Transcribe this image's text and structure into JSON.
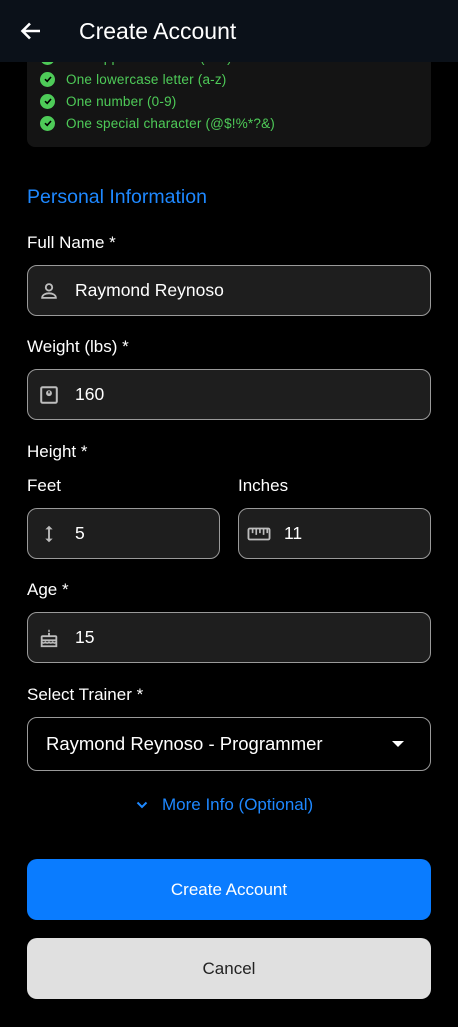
{
  "appbar": {
    "title": "Create Account",
    "back_icon": "arrow-left-icon"
  },
  "password_requirements": [
    {
      "text": "One uppercase letter (A-Z)",
      "met": true
    },
    {
      "text": "One lowercase letter (a-z)",
      "met": true
    },
    {
      "text": "One number (0-9)",
      "met": true
    },
    {
      "text": "One special character (@$!%*?&)",
      "met": true
    }
  ],
  "personal": {
    "section_title": "Personal Information",
    "full_name": {
      "label": "Full Name *",
      "value": "Raymond Reynoso",
      "icon": "person-icon"
    },
    "weight": {
      "label": "Weight (lbs) *",
      "value": "160",
      "icon": "scale-icon"
    },
    "height": {
      "label": "Height *",
      "feet": {
        "label": "Feet",
        "value": "5",
        "icon": "vertical-arrows-icon"
      },
      "inches": {
        "label": "Inches",
        "value": "11",
        "icon": "ruler-icon"
      }
    },
    "age": {
      "label": "Age *",
      "value": "15",
      "icon": "cake-icon"
    },
    "trainer": {
      "label": "Select Trainer *",
      "value": "Raymond Reynoso - Programmer"
    }
  },
  "more_info": {
    "label": "More Info (Optional)"
  },
  "buttons": {
    "create": "Create Account",
    "cancel": "Cancel"
  },
  "colors": {
    "accent": "#1e88ff",
    "primary_button": "#0a7cff",
    "success": "#4ecb58",
    "appbar": "#0b1119"
  }
}
